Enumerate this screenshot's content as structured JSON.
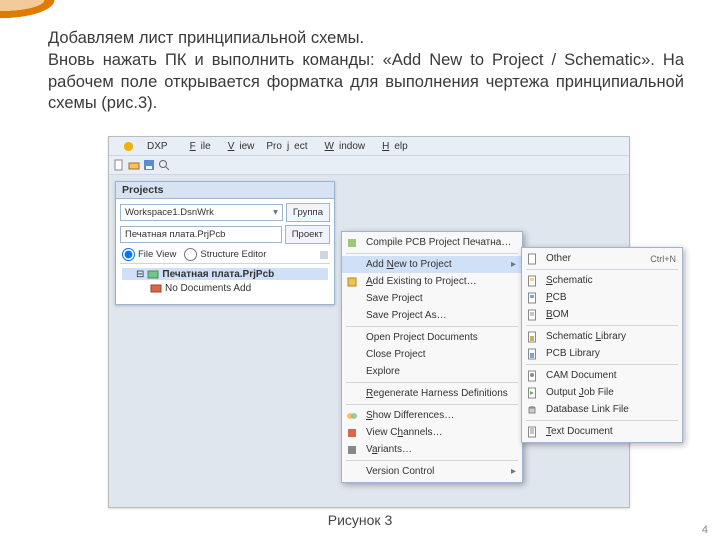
{
  "page": {
    "number": "4",
    "caption": "Рисунок 3",
    "paragraph1": "Добавляем лист принципиальной схемы.",
    "paragraph2": "Вновь нажать ПК и выполнить команды: «Add New to Project / Schematic». На рабочем поле открывается форматка для выполнения чертежа принципиальной схемы (рис.3)."
  },
  "menubar": {
    "dxp": "DXP",
    "file": "File",
    "view": "View",
    "project": "Project",
    "window": "Window",
    "help": "Help"
  },
  "projects_panel": {
    "title": "Projects",
    "workspace": "Workspace1.DsnWrk",
    "workspace_btn": "Группа",
    "project": "Печатная плата.PrjPcb",
    "project_btn": "Проект",
    "file_view": "File View",
    "structure_editor": "Structure Editor",
    "tree_root": "Печатная плата.PrjPcb",
    "tree_sub": "No Documents Add"
  },
  "context_menu": {
    "compile": "Compile PCB Project Печатная плата.PrjPcb",
    "add_new": "Add New to Project",
    "add_existing": "Add Existing to Project…",
    "save_project": "Save Project",
    "save_project_as": "Save Project As…",
    "open_docs": "Open Project Documents",
    "close_project": "Close Project",
    "explore": "Explore",
    "regenerate": "Regenerate Harness Definitions",
    "show_diff": "Show Differences…",
    "view_channels": "View Channels…",
    "variants": "Variants…",
    "version_control": "Version Control"
  },
  "submenu": {
    "other": "Other",
    "other_kbd": "Ctrl+N",
    "schematic": "Schematic",
    "pcb": "PCB",
    "bom": "BOM",
    "schematic_lib": "Schematic Library",
    "pcb_lib": "PCB Library",
    "cam_doc": "CAM Document",
    "output_job": "Output Job File",
    "db_link": "Database Link File",
    "text_doc": "Text Document"
  }
}
